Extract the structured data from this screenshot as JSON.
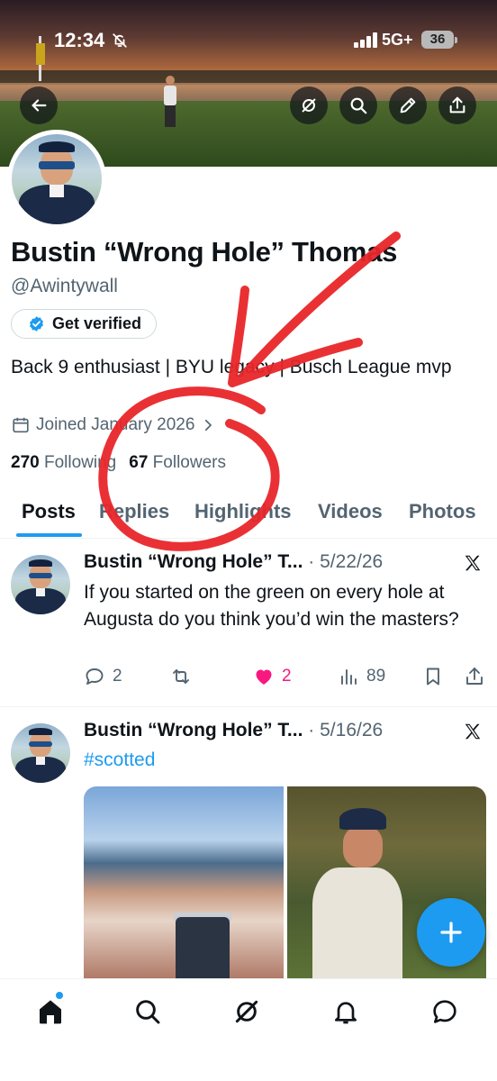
{
  "status_bar": {
    "time": "12:34",
    "network": "5G+",
    "battery": "36"
  },
  "header_buttons": [
    "back-icon",
    "grok-icon",
    "search-icon",
    "edit-icon",
    "share-icon"
  ],
  "profile": {
    "name": "Bustin “Wrong Hole” Thomas",
    "handle": "@Awintywall",
    "verify_label": "Get verified",
    "bio": "Back 9 enthusiast | BYU legacy | Busch League mvp",
    "joined": "Joined January 2026",
    "following_count": "270",
    "following_label": "Following",
    "followers_count": "67",
    "followers_label": "Followers"
  },
  "tabs": [
    {
      "label": "Posts",
      "active": true
    },
    {
      "label": "Replies",
      "active": false
    },
    {
      "label": "Highlights",
      "active": false
    },
    {
      "label": "Videos",
      "active": false
    },
    {
      "label": "Photos",
      "active": false
    }
  ],
  "posts": [
    {
      "author": "Bustin “Wrong Hole” T...",
      "date": "· 5/22/26",
      "text": "If you started on the green on every hole at Augusta do you think you’d win the masters?",
      "replies": "2",
      "retweets": "",
      "likes": "2",
      "views": "89"
    },
    {
      "author": "Bustin “Wrong Hole” T...",
      "date": "· 5/16/26",
      "text": "#scotted"
    }
  ],
  "bottom_nav": [
    "home-icon",
    "search-icon",
    "grok-icon",
    "notifications-icon",
    "messages-icon"
  ],
  "colors": {
    "accent": "#1d9bf0",
    "like": "#f91880",
    "secondary_text": "#536471",
    "annotation": "#e8262a"
  }
}
